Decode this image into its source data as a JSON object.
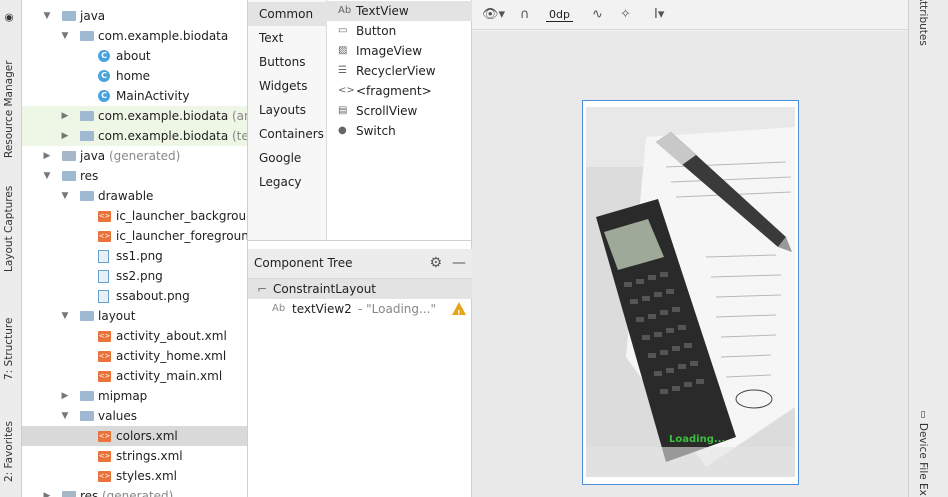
{
  "left_tabs": {
    "resource_manager": "Resource Manager",
    "layout_captures": "Layout Captures",
    "structure": "7: Structure",
    "favorites": "2: Favorites"
  },
  "project_tree": [
    {
      "label": "java",
      "kind": "folder",
      "arrow": "▼",
      "depth": 1
    },
    {
      "label": "com.example.biodata",
      "kind": "folder",
      "arrow": "▼",
      "depth": 2
    },
    {
      "label": "about",
      "kind": "class",
      "depth": 3
    },
    {
      "label": "home",
      "kind": "class",
      "depth": 3
    },
    {
      "label": "MainActivity",
      "kind": "class",
      "depth": 3
    },
    {
      "label": "com.example.biodata",
      "suffix": "(andro",
      "kind": "folder",
      "arrow": "▶",
      "depth": 2,
      "alt": true
    },
    {
      "label": "com.example.biodata",
      "suffix": "(test)",
      "kind": "folder",
      "arrow": "▶",
      "depth": 2,
      "alt": true
    },
    {
      "label": "java",
      "suffix": "(generated)",
      "kind": "genfolder",
      "arrow": "▶",
      "depth": 1
    },
    {
      "label": "res",
      "kind": "folder",
      "arrow": "▼",
      "depth": 1
    },
    {
      "label": "drawable",
      "kind": "folder",
      "arrow": "▼",
      "depth": 2
    },
    {
      "label": "ic_launcher_background.",
      "kind": "xml",
      "depth": 3
    },
    {
      "label": "ic_launcher_foreground.x",
      "kind": "xml",
      "depth": 3
    },
    {
      "label": "ss1.png",
      "kind": "image",
      "depth": 3
    },
    {
      "label": "ss2.png",
      "kind": "image",
      "depth": 3
    },
    {
      "label": "ssabout.png",
      "kind": "image",
      "depth": 3
    },
    {
      "label": "layout",
      "kind": "folder",
      "arrow": "▼",
      "depth": 2
    },
    {
      "label": "activity_about.xml",
      "kind": "xml",
      "depth": 3
    },
    {
      "label": "activity_home.xml",
      "kind": "xml",
      "depth": 3
    },
    {
      "label": "activity_main.xml",
      "kind": "xml",
      "depth": 3
    },
    {
      "label": "mipmap",
      "kind": "folder",
      "arrow": "▶",
      "depth": 2
    },
    {
      "label": "values",
      "kind": "folder",
      "arrow": "▼",
      "depth": 2
    },
    {
      "label": "colors.xml",
      "kind": "xml",
      "depth": 3,
      "selected": true
    },
    {
      "label": "strings.xml",
      "kind": "xml",
      "depth": 3
    },
    {
      "label": "styles.xml",
      "kind": "xml",
      "depth": 3
    },
    {
      "label": "res",
      "suffix": "(generated)",
      "kind": "genfolder",
      "arrow": "▶",
      "depth": 1
    }
  ],
  "palette": {
    "categories": [
      "Common",
      "Text",
      "Buttons",
      "Widgets",
      "Layouts",
      "Containers",
      "Google",
      "Legacy"
    ],
    "active_category": "Common",
    "items": [
      {
        "icon": "Ab",
        "label": "TextView",
        "active": true
      },
      {
        "icon": "▭",
        "label": "Button"
      },
      {
        "icon": "▨",
        "label": "ImageView"
      },
      {
        "icon": "☰",
        "label": "RecyclerView"
      },
      {
        "icon": "<>",
        "label": "<fragment>"
      },
      {
        "icon": "▤",
        "label": "ScrollView"
      },
      {
        "icon": "●",
        "label": "Switch"
      }
    ]
  },
  "component_tree": {
    "title": "Component Tree",
    "root": "ConstraintLayout",
    "child_icon": "Ab",
    "child": "textView2",
    "child_hint": "- \"Loading...\""
  },
  "toolbar": {
    "margin_value": "0dp"
  },
  "device": {
    "loading_text": "Loading..."
  },
  "right_tabs": {
    "attributes": "Attributes",
    "device_file": "Device File Ex"
  }
}
